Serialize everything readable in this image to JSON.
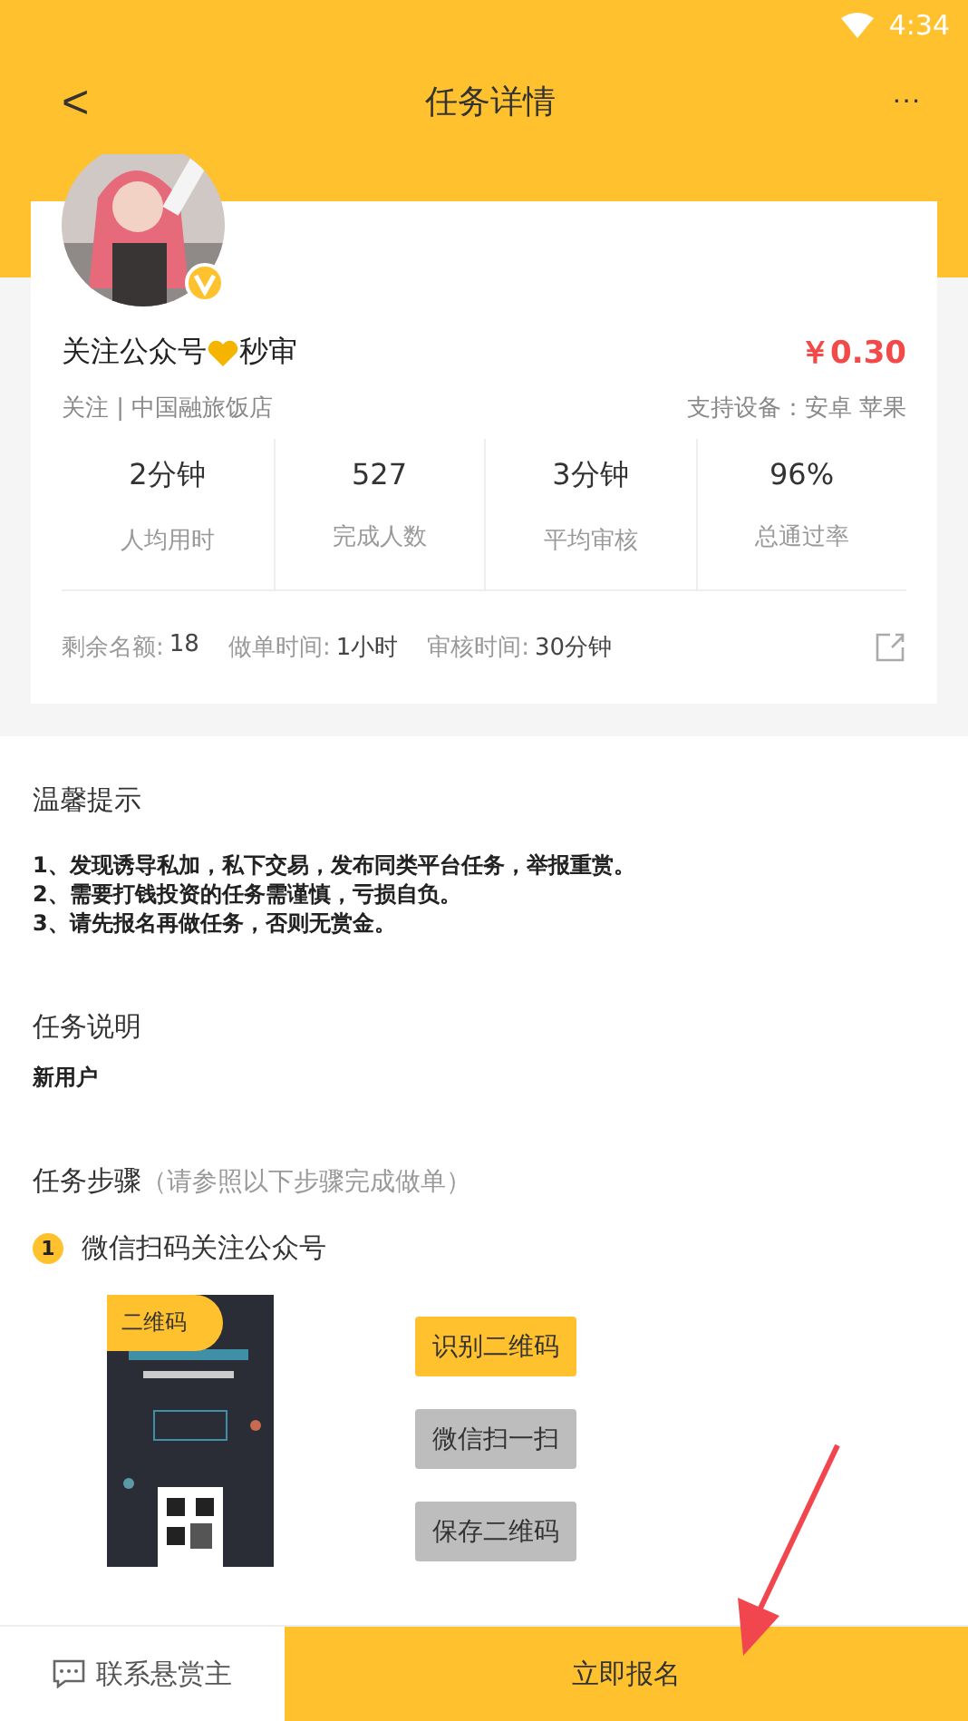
{
  "status_bar": {
    "time": "4:34"
  },
  "header": {
    "title": "任务详情",
    "back_icon": "<",
    "more_icon": "···"
  },
  "task": {
    "title_before": "关注公众号",
    "title_after": "秒审",
    "verified": true,
    "price": "￥0.30",
    "subtitle": "关注 | 中国融旅饭店",
    "devices": "支持设备：安卓  苹果",
    "stats": [
      {
        "value": "2分钟",
        "label": "人均用时"
      },
      {
        "value": "527",
        "label": "完成人数"
      },
      {
        "value": "3分钟",
        "label": "平均审核"
      },
      {
        "value": "96%",
        "label": "总通过率"
      }
    ],
    "info": [
      {
        "label": "剩余名额:",
        "value": "18"
      },
      {
        "label": "做单时间:",
        "value": "1小时"
      },
      {
        "label": "审核时间:",
        "value": "30分钟"
      }
    ]
  },
  "tips": {
    "title": "温馨提示",
    "lines": [
      "1、发现诱导私加，私下交易，发布同类平台任务，举报重赏。",
      "2、需要打钱投资的任务需谨慎，亏损自负。",
      "3、请先报名再做任务，否则无赏金。"
    ]
  },
  "description": {
    "title": "任务说明",
    "text": "新用户"
  },
  "steps": {
    "title": "任务步骤",
    "hint": "（请参照以下步骤完成做单）",
    "items": [
      {
        "number": "1",
        "text": "微信扫码关注公众号",
        "image_label": "二维码",
        "buttons": [
          {
            "label": "识别二维码",
            "highlighted": true
          },
          {
            "label": "微信扫一扫",
            "highlighted": false
          },
          {
            "label": "保存二维码",
            "highlighted": false
          }
        ]
      }
    ]
  },
  "bottom_bar": {
    "contact": "联系悬赏主",
    "signup": "立即报名"
  }
}
